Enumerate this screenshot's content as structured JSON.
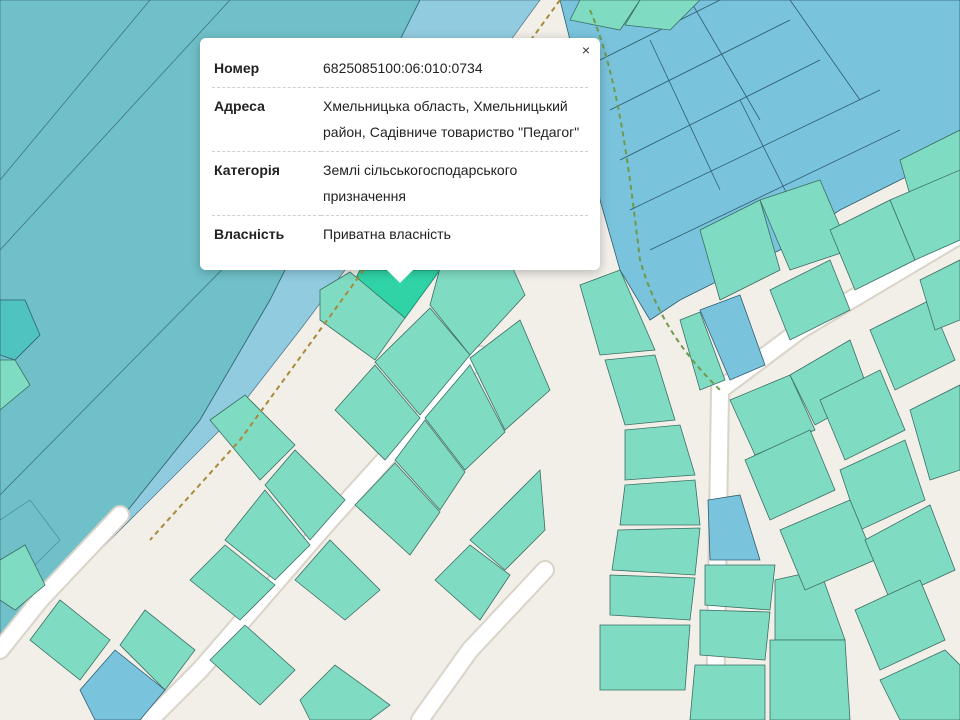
{
  "popup": {
    "close_label": "×",
    "rows": [
      {
        "label": "Номер",
        "value": "6825085100:06:010:0734"
      },
      {
        "label": "Адреса",
        "value": "Хмельницька область, Хмельницький район, Садівниче товариство \"Педагог\""
      },
      {
        "label": "Категорія",
        "value": "Землі сільськогосподарського призначення"
      },
      {
        "label": "Власність",
        "value": "Приватна власність"
      }
    ]
  },
  "map": {
    "colors": {
      "background": "#f2efe9",
      "parcel_agricultural": "#7fdcc3",
      "parcel_blue": "#79c3dd",
      "parcel_large": "#70c0c9",
      "parcel_selected": "#2fd3a6",
      "road": "#ffffff"
    }
  }
}
